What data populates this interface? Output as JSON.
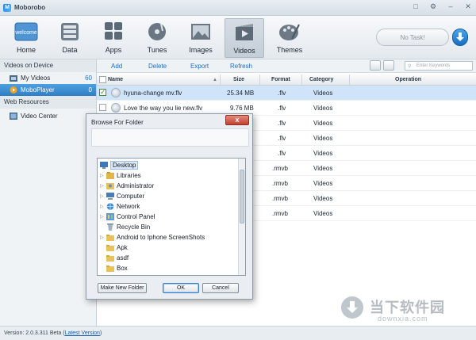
{
  "window": {
    "title": "Moborobo",
    "logo_letter": "M"
  },
  "toolbar": {
    "items": [
      {
        "label": "Home",
        "icon": "welcome-home-icon",
        "icon_text": "welcome"
      },
      {
        "label": "Data",
        "icon": "data-icon"
      },
      {
        "label": "Apps",
        "icon": "apps-icon"
      },
      {
        "label": "Tunes",
        "icon": "tunes-icon"
      },
      {
        "label": "Images",
        "icon": "images-icon"
      },
      {
        "label": "Videos",
        "icon": "videos-icon",
        "active": true
      },
      {
        "label": "Themes",
        "icon": "themes-icon"
      }
    ],
    "task_label": "No Task!"
  },
  "sidebar": {
    "sections": [
      {
        "title": "Videos on Device",
        "items": [
          {
            "label": "My Videos",
            "count": "60",
            "icon": "video-folder-icon"
          },
          {
            "label": "MoboPlayer",
            "count": "0",
            "icon": "moboplayer-icon",
            "selected": true
          }
        ]
      },
      {
        "title": "Web Resources",
        "items": [
          {
            "label": "Video Center",
            "icon": "video-center-icon"
          }
        ]
      }
    ]
  },
  "actions": [
    "Add",
    "Delete",
    "Export",
    "Refresh"
  ],
  "search": {
    "placeholder": "Enter Keywords"
  },
  "table": {
    "columns": [
      "Name",
      "Size",
      "Format",
      "Category",
      "Operation"
    ],
    "rows": [
      {
        "name": "hyuna-change mv.flv",
        "size": "25.34 MB",
        "format": ".flv",
        "category": "Videos",
        "checked": true,
        "selected": true
      },
      {
        "name": "Love the way you lie new.flv",
        "size": "9.76 MB",
        "format": ".flv",
        "category": "Videos"
      },
      {
        "name": "",
        "size": "",
        "format": ".flv",
        "category": "Videos"
      },
      {
        "name": "",
        "size": "",
        "format": ".flv",
        "category": "Videos"
      },
      {
        "name": "",
        "size": "",
        "format": ".flv",
        "category": "Videos"
      },
      {
        "name": "",
        "size": "",
        "format": ".rmvb",
        "category": "Videos"
      },
      {
        "name": "",
        "size": "",
        "format": ".rmvb",
        "category": "Videos"
      },
      {
        "name": "",
        "size": "",
        "format": ".rmvb",
        "category": "Videos"
      },
      {
        "name": "",
        "size": "",
        "format": ".rmvb",
        "category": "Videos"
      }
    ]
  },
  "dialog": {
    "title": "Browse For Folder",
    "close": "x",
    "tree": [
      {
        "label": "Desktop",
        "icon": "desktop-icon",
        "level": 0,
        "selected": true
      },
      {
        "label": "Libraries",
        "icon": "libraries-icon",
        "level": 1,
        "expandable": true
      },
      {
        "label": "Administrator",
        "icon": "user-folder-icon",
        "level": 1,
        "expandable": true
      },
      {
        "label": "Computer",
        "icon": "computer-icon",
        "level": 1,
        "expandable": true
      },
      {
        "label": "Network",
        "icon": "network-icon",
        "level": 1,
        "expandable": true
      },
      {
        "label": "Control Panel",
        "icon": "control-panel-icon",
        "level": 1,
        "expandable": true
      },
      {
        "label": "Recycle Bin",
        "icon": "recycle-bin-icon",
        "level": 1
      },
      {
        "label": "Android to Iphone ScreenShots",
        "icon": "folder-icon",
        "level": 1,
        "expandable": true
      },
      {
        "label": "Apk",
        "icon": "folder-icon",
        "level": 1
      },
      {
        "label": "asdf",
        "icon": "folder-icon",
        "level": 1
      },
      {
        "label": "Box",
        "icon": "folder-icon",
        "level": 1
      }
    ],
    "buttons": {
      "new_folder": "Make New Folder",
      "ok": "OK",
      "cancel": "Cancel"
    }
  },
  "status": {
    "version": "Version: 2.0.3.311 Beta",
    "link": "Latest Version"
  },
  "watermark": {
    "cn": "当下软件园",
    "en": "downxia.com"
  },
  "colors": {
    "accent": "#2f7fc6",
    "link": "#1d6cc2",
    "dialog_close": "#c4412e"
  }
}
